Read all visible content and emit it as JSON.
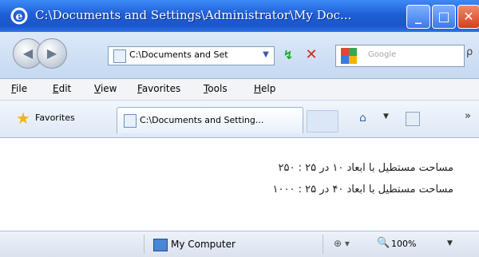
{
  "window": {
    "title": "C:\\Documents and Settings\\Administrator\\My Doc...",
    "minimize_label": "_",
    "maximize_label": "□",
    "close_label": "✕"
  },
  "navbar": {
    "back_label": "◀",
    "forward_label": "▶",
    "address": "C:\\Documents and Set",
    "dropdown_label": "▼",
    "go_label": "↯",
    "stop_label": "✕",
    "search_placeholder": "Google",
    "more_label": "ρ"
  },
  "menu": {
    "items": [
      "File",
      "Edit",
      "View",
      "Favorites",
      "Tools",
      "Help"
    ]
  },
  "favorites_bar": {
    "favorites_label": "Favorites",
    "tab_title": "C:\\Documents and Setting...",
    "home_label": "⌂",
    "home_drop": "▼",
    "more_label": "»"
  },
  "content": {
    "line1": "مساحت مستطیل با ابعاد ۱۰ در ۲۵ : ۲۵۰",
    "line2": "مساحت مستطیل با ابعاد ۴۰ در ۲۵ : ۱۰۰۰"
  },
  "statusbar": {
    "zone": "My Computer",
    "protected": "⊕ ▾",
    "zoom_icon": "🔍",
    "zoom": "100%",
    "zoom_drop": "▼"
  },
  "colors": {
    "title_bar": "#1e5fd6",
    "close_button": "#d3401c",
    "favorites_star": "#f2b21b"
  }
}
